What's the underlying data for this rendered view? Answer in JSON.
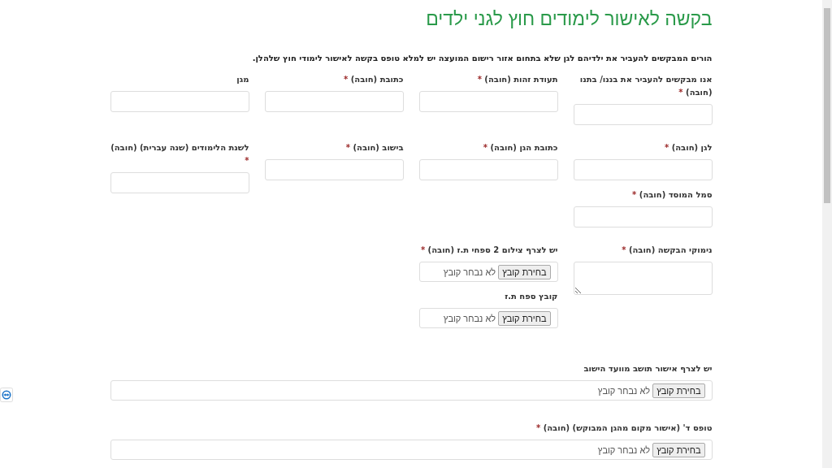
{
  "title": "בקשה לאישור לימודים חוץ לגני ילדים",
  "intro": "הורים המבקשים להעביר את ילדיהם לגן שלא בתחום אזור רישום המועצה יש למלא טופס בקשה לאישור לימודי חוץ שלהלן.",
  "rows": [
    {
      "columns": [
        [
          {
            "kind": "text",
            "label": "אנו מבקשים להעביר את בננו/ בתנו (חובה)",
            "required_mark": "*"
          }
        ],
        [
          {
            "kind": "text",
            "label": "תעודת זהות (חובה)",
            "required_mark": "*"
          }
        ],
        [
          {
            "kind": "text",
            "label": "כתובת (חובה)",
            "required_mark": "*"
          }
        ],
        [
          {
            "kind": "text",
            "label": "מגן"
          }
        ]
      ]
    },
    {
      "columns": [
        [
          {
            "kind": "text",
            "label": "לגן (חובה)",
            "required_mark": "*"
          },
          {
            "kind": "text",
            "label": "סמל המוסד (חובה)",
            "required_mark": "*"
          }
        ],
        [
          {
            "kind": "text",
            "label": "כתובת הגן (חובה)",
            "required_mark": "*"
          }
        ],
        [
          {
            "kind": "text",
            "label": "בישוב (חובה)",
            "required_mark": "*"
          }
        ],
        [
          {
            "kind": "text",
            "label": "לשנת הלימודים (שנה עברית) (חובה)",
            "required_mark": "*"
          }
        ]
      ]
    },
    {
      "columns": [
        [
          {
            "kind": "textarea",
            "label": "נימוקי הבקשה (חובה)",
            "required_mark": "*"
          }
        ],
        [
          {
            "kind": "file",
            "label": "יש לצרף צילום 2 ספחי ת.ז (חובה)",
            "required_mark": "*",
            "button": "בחירת קובץ",
            "status": "לא נבחר קובץ"
          },
          {
            "kind": "file",
            "label": "קובץ ספח ת.ז",
            "button": "בחירת קובץ",
            "status": "לא נבחר קובץ"
          }
        ]
      ]
    }
  ],
  "wide_fields": [
    {
      "kind": "file",
      "label": "יש לצרף אישור תושב מוועד הישוב",
      "button": "בחירת קובץ",
      "status": "לא נבחר קובץ"
    },
    {
      "kind": "file",
      "label": "טופס ד' (אישור מקום מהגן המבוקש) (חובה)",
      "required_mark": "*",
      "button": "בחירת קובץ",
      "status": "לא נבחר קובץ"
    }
  ]
}
